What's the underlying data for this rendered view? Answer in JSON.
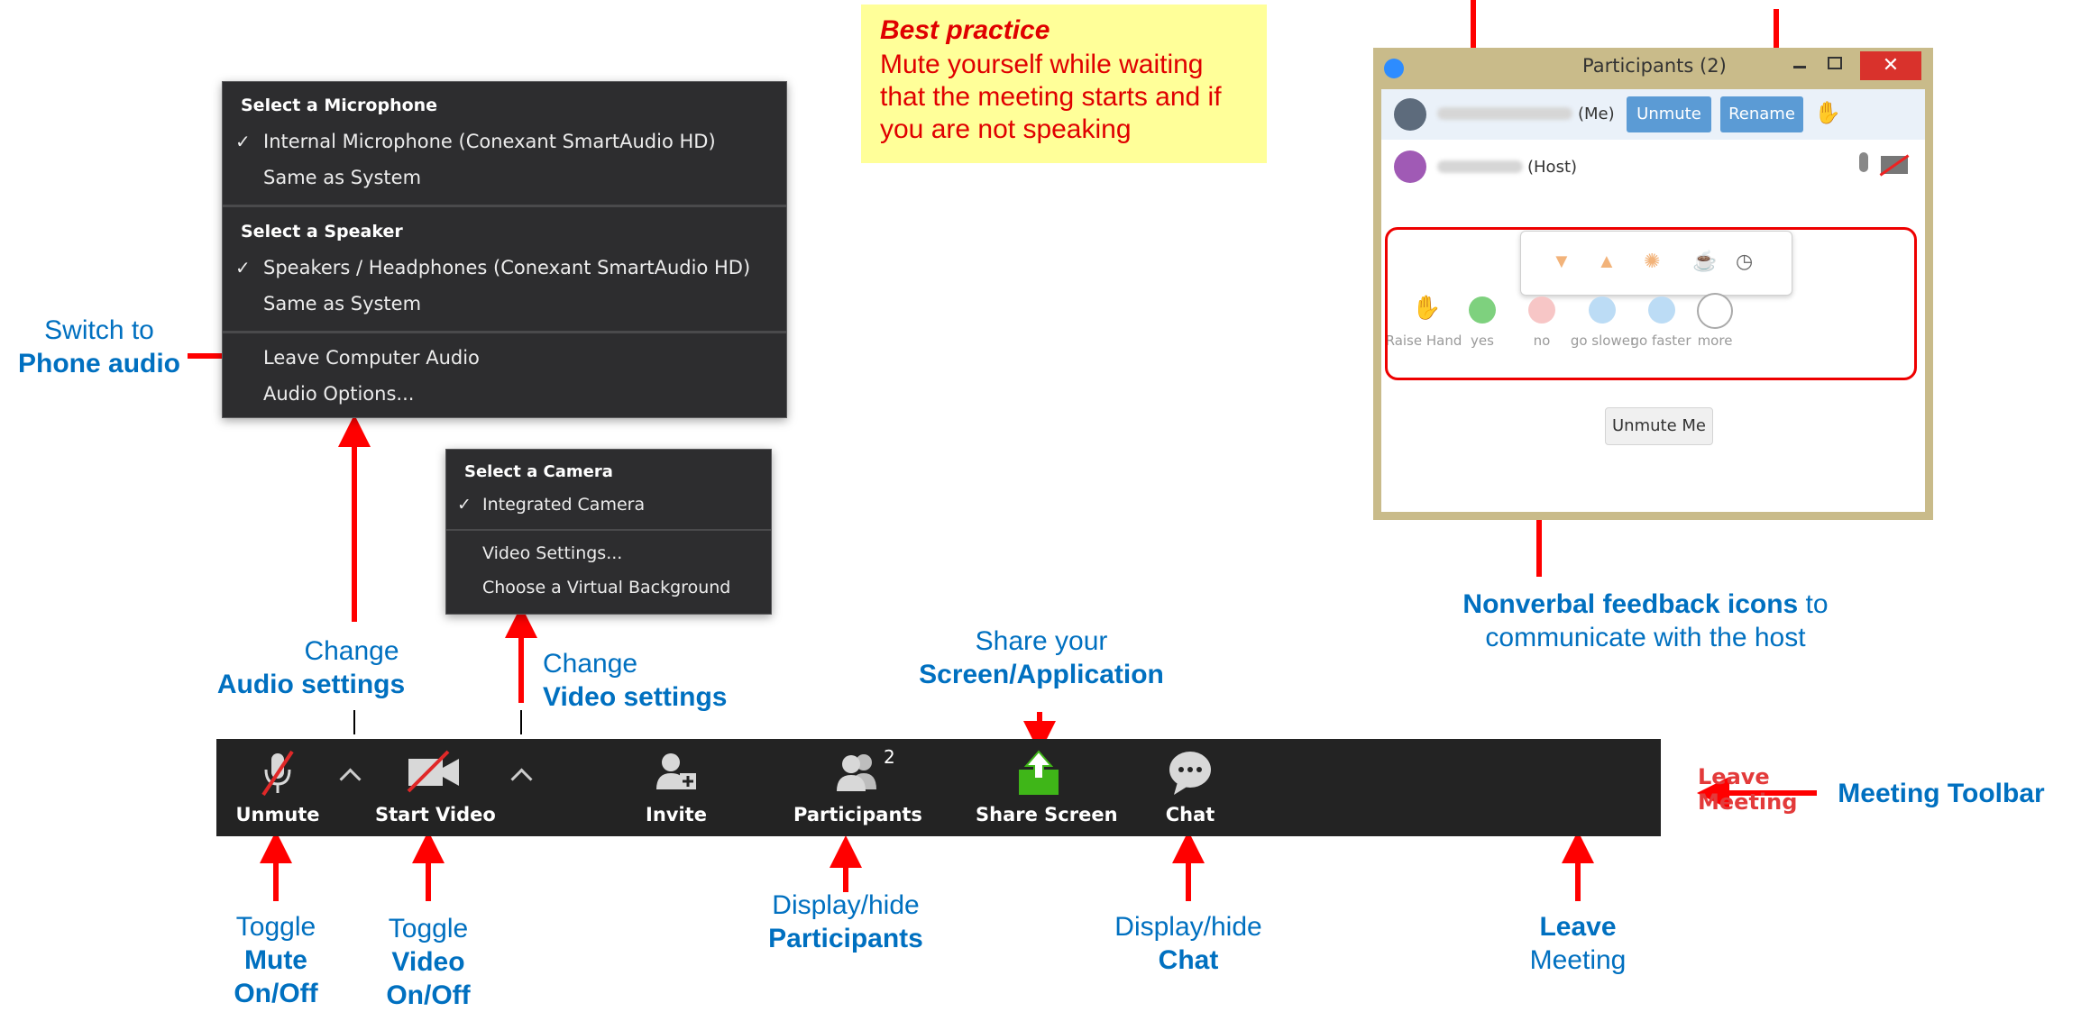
{
  "note": {
    "title": "Best practice",
    "lines": [
      "Mute yourself while waiting",
      "that the meeting starts and if",
      "you are not speaking"
    ]
  },
  "audio_menu": {
    "mic_header": "Select a Microphone",
    "mic_selected": "Internal Microphone (Conexant SmartAudio HD)",
    "mic_same": "Same as System",
    "spk_header": "Select a Speaker",
    "spk_selected": "Speakers / Headphones (Conexant SmartAudio HD)",
    "spk_same": "Same as System",
    "leave_audio": "Leave Computer Audio",
    "options": "Audio Options...",
    "check": "✓"
  },
  "video_menu": {
    "header": "Select a Camera",
    "camera_selected": "Integrated Camera",
    "settings": "Video Settings...",
    "virtual_bg": "Choose a Virtual Background",
    "check": "✓"
  },
  "participants": {
    "title": "Participants (2)",
    "me_suffix": "(Me)",
    "host_suffix": "(Host)",
    "unmute": "Unmute",
    "rename": "Rename",
    "unmute_me": "Unmute Me",
    "feedback": [
      "Raise Hand",
      "yes",
      "no",
      "go slower",
      "go faster",
      "more"
    ]
  },
  "toolbar": {
    "unmute": "Unmute",
    "start_video": "Start Video",
    "invite": "Invite",
    "participants": "Participants",
    "participant_count": "2",
    "share": "Share Screen",
    "chat": "Chat",
    "leave": "Leave Meeting"
  },
  "annotations": {
    "switch_1": "Switch to",
    "switch_2": "Phone audio",
    "audio_1": "Change",
    "audio_2": "Audio settings",
    "video_1": "Change",
    "video_2": "Video settings",
    "share_1": "Share your",
    "share_2": "Screen/Application",
    "nonverbal_b": "Nonverbal feedback icons",
    "nonverbal_r": " to",
    "nonverbal_2": "communicate with the host",
    "meeting_toolbar": "Meeting Toolbar",
    "mute_1": "Toggle",
    "mute_2": "Mute",
    "mute_3": "On/Off",
    "vid_1": "Toggle",
    "vid_2": "Video",
    "vid_3": "On/Off",
    "part_1": "Display/hide",
    "part_2": "Participants",
    "chat_1": "Display/hide",
    "chat_2": "Chat",
    "leave_1": "Leave",
    "leave_2": "Meeting"
  },
  "colors": {
    "annotation": "#0070c0",
    "arrow": "#ff0000",
    "note_bg": "#ffff99",
    "toolbar_bg": "#232323",
    "leave": "#e33a3a",
    "share_green": "#3fb618"
  }
}
